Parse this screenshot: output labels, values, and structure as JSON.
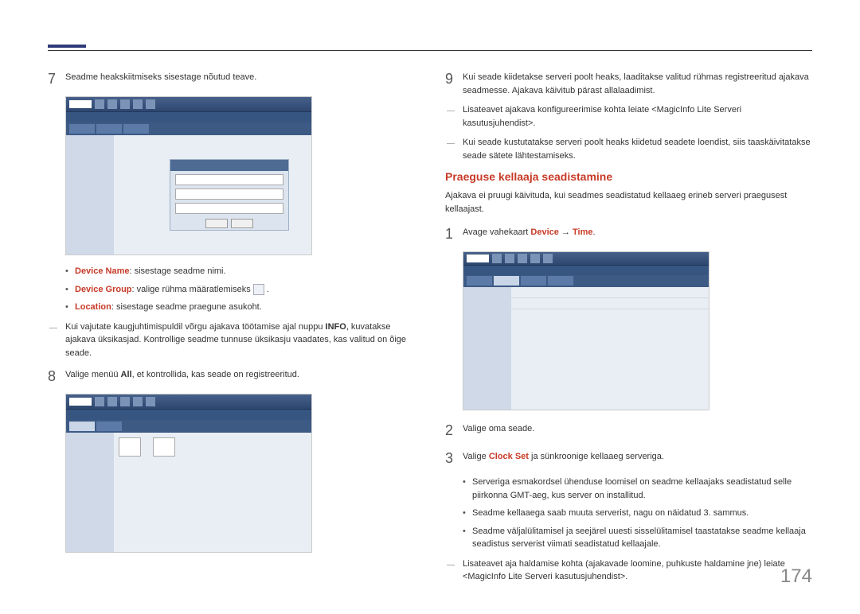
{
  "left": {
    "step7": "Seadme heakskiitmiseks sisestage nõutud teave.",
    "b1_label": "Device Name",
    "b1_text": ": sisestage seadme nimi.",
    "b2_label": "Device Group",
    "b2_text": ": valige rühma määratlemiseks ",
    "b3_label": "Location",
    "b3_text": ": sisestage seadme praegune asukoht.",
    "note7a": "Kui vajutate kaugjuhtimispuldil võrgu ajakava töötamise ajal nuppu ",
    "note7_info": "INFO",
    "note7b": ", kuvatakse ajakava üksikasjad. Kontrollige seadme tunnuse üksikasju vaadates, kas valitud on õige seade.",
    "step8a": "Valige menüü ",
    "step8_all": "All",
    "step8b": ", et kontrollida, kas seade on registreeritud."
  },
  "right": {
    "step9": "Kui seade kiidetakse serveri poolt heaks, laaditakse valitud rühmas registreeritud ajakava seadmesse. Ajakava käivitub pärast allalaadimist.",
    "note9a": "Lisateavet ajakava konfigureerimise kohta leiate <MagicInfo Lite Serveri kasutusjuhendist>.",
    "note9b": "Kui seade kustutatakse serveri poolt heaks kiidetud seadete loendist, siis taaskäivitatakse seade sätete lähtestamiseks.",
    "heading": "Praeguse kellaaja seadistamine",
    "intro": "Ajakava ei pruugi käivituda, kui seadmes seadistatud kellaaeg erineb serveri praegusest kellaajast.",
    "step1a": "Avage vahekaart ",
    "step1_device": "Device",
    "step1_arrow": " → ",
    "step1_time": "Time",
    "step1_dot": ".",
    "step2": "Valige oma seade.",
    "step3a": "Valige ",
    "step3_clock": "Clock Set",
    "step3b": " ja sünkroonige kellaaeg serveriga.",
    "b_c1": "Serveriga esmakordsel ühenduse loomisel on seadme kellaajaks seadistatud selle piirkonna GMT-aeg, kus server on installitud.",
    "b_c2": "Seadme kellaaega saab muuta serverist, nagu on näidatud 3. sammus.",
    "b_c3": "Seadme väljalülitamisel ja seejärel uuesti sisselülitamisel taastatakse seadme kellaaja seadistus serverist viimati seadistatud kellaajale.",
    "note_end": "Lisateavet aja haldamise kohta (ajakavade loomine, puhkuste haldamine jne) leiate <MagicInfo Lite Serveri kasutusjuhendist>."
  },
  "page": "174"
}
